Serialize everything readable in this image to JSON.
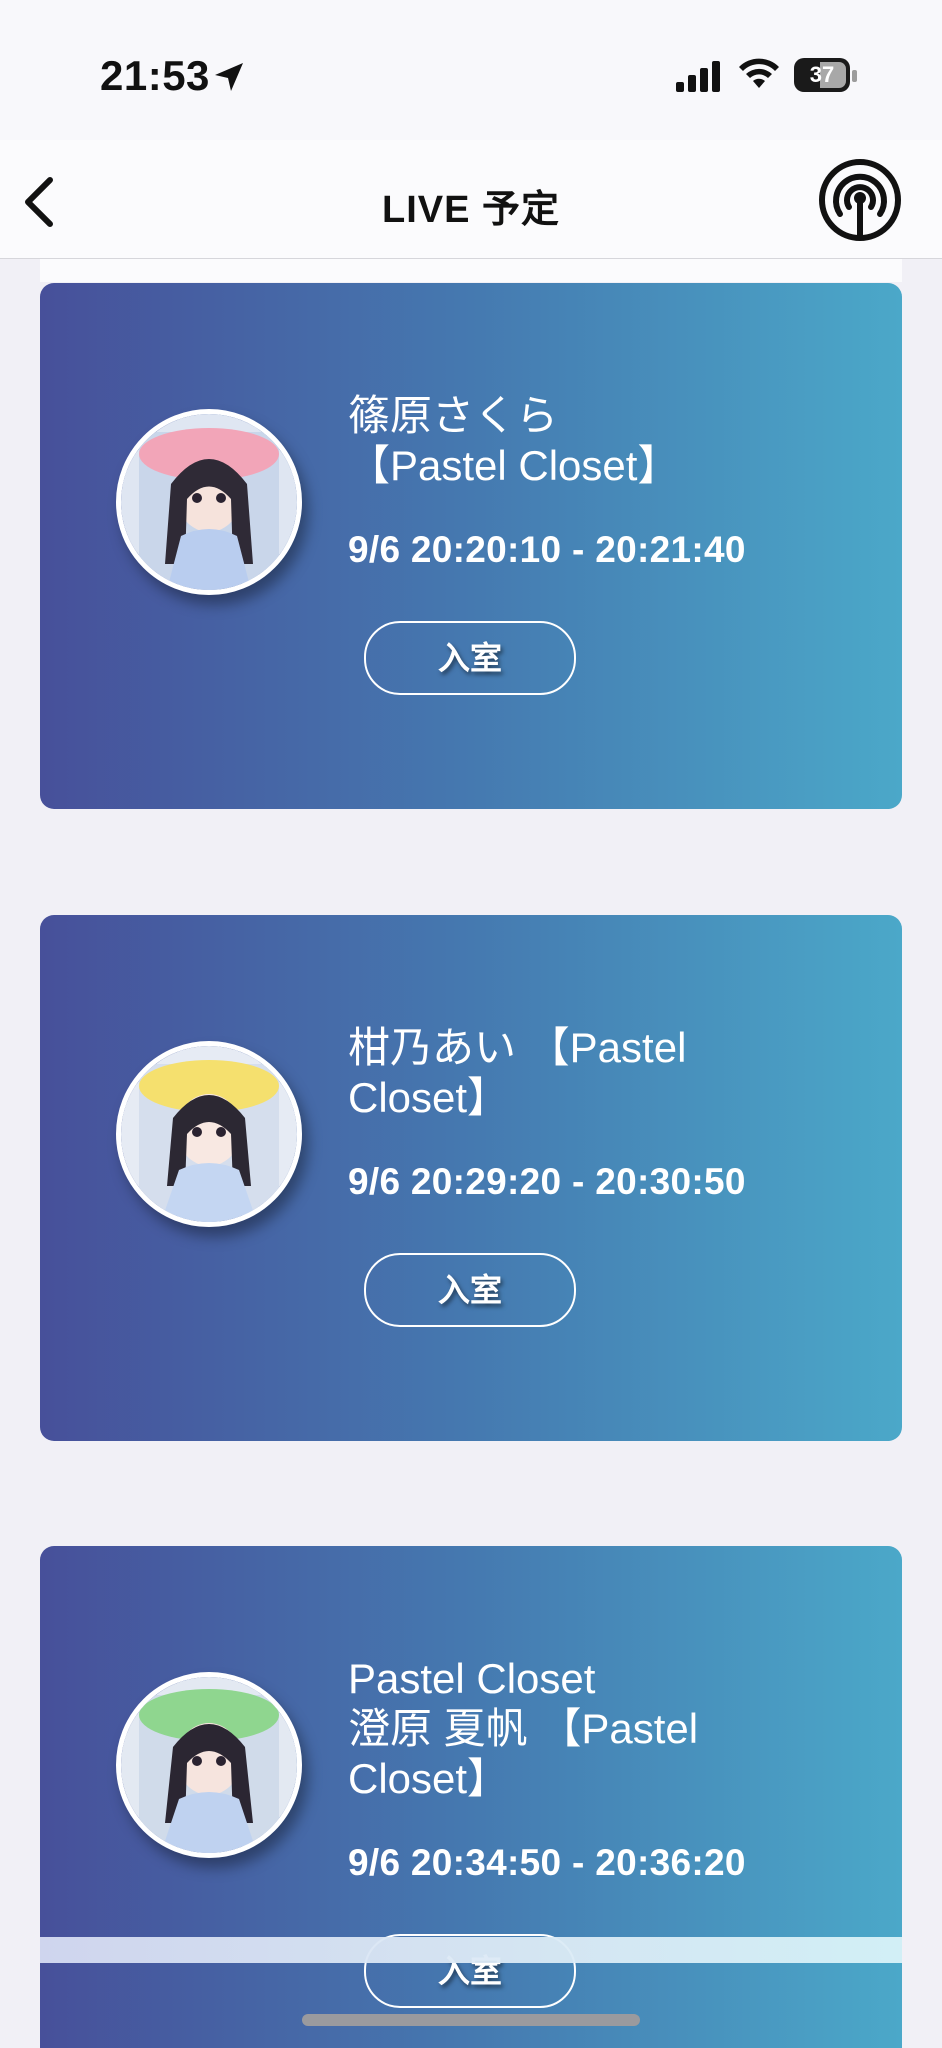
{
  "status_bar": {
    "time": "21:53",
    "battery": "37",
    "icons": [
      "location-arrow-icon",
      "cellular-signal-icon",
      "wifi-icon",
      "battery-icon"
    ]
  },
  "nav": {
    "title": "LIVE 予定",
    "back_icon": "chevron-left-icon",
    "right_icon": "live-broadcast-icon"
  },
  "cards": [
    {
      "name": "篠原さくら\n【Pastel Closet】",
      "time": "9/6 20:20:10 - 20:21:40",
      "enter_label": "入室",
      "ribbon_color": "#f2a5b8"
    },
    {
      "name": "柑乃あい 【Pastel Closet】",
      "time": "9/6 20:29:20 - 20:30:50",
      "enter_label": "入室",
      "ribbon_color": "#f5e06e"
    },
    {
      "name": "Pastel Closet\n澄原 夏帆 【Pastel Closet】",
      "time": "9/6 20:34:50 - 20:36:20",
      "enter_label": "入室",
      "ribbon_color": "#8fd68f"
    }
  ],
  "colors": {
    "card_gradient_start": "#47509a",
    "card_gradient_end": "#4ba8c9",
    "background": "#f1f0f6"
  }
}
